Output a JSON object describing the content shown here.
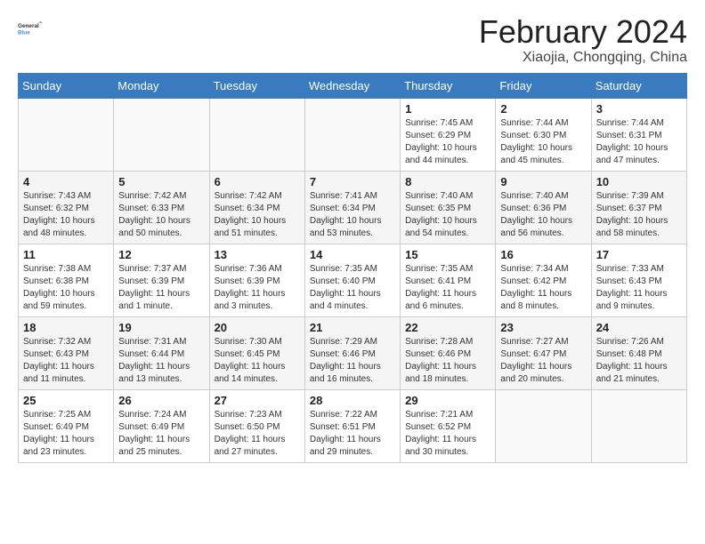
{
  "logo": {
    "text_general": "General",
    "text_blue": "Blue"
  },
  "header": {
    "title": "February 2024",
    "subtitle": "Xiaojia, Chongqing, China"
  },
  "weekdays": [
    "Sunday",
    "Monday",
    "Tuesday",
    "Wednesday",
    "Thursday",
    "Friday",
    "Saturday"
  ],
  "weeks": [
    [
      {
        "day": "",
        "info": ""
      },
      {
        "day": "",
        "info": ""
      },
      {
        "day": "",
        "info": ""
      },
      {
        "day": "",
        "info": ""
      },
      {
        "day": "1",
        "info": "Sunrise: 7:45 AM\nSunset: 6:29 PM\nDaylight: 10 hours and 44 minutes."
      },
      {
        "day": "2",
        "info": "Sunrise: 7:44 AM\nSunset: 6:30 PM\nDaylight: 10 hours and 45 minutes."
      },
      {
        "day": "3",
        "info": "Sunrise: 7:44 AM\nSunset: 6:31 PM\nDaylight: 10 hours and 47 minutes."
      }
    ],
    [
      {
        "day": "4",
        "info": "Sunrise: 7:43 AM\nSunset: 6:32 PM\nDaylight: 10 hours and 48 minutes."
      },
      {
        "day": "5",
        "info": "Sunrise: 7:42 AM\nSunset: 6:33 PM\nDaylight: 10 hours and 50 minutes."
      },
      {
        "day": "6",
        "info": "Sunrise: 7:42 AM\nSunset: 6:34 PM\nDaylight: 10 hours and 51 minutes."
      },
      {
        "day": "7",
        "info": "Sunrise: 7:41 AM\nSunset: 6:34 PM\nDaylight: 10 hours and 53 minutes."
      },
      {
        "day": "8",
        "info": "Sunrise: 7:40 AM\nSunset: 6:35 PM\nDaylight: 10 hours and 54 minutes."
      },
      {
        "day": "9",
        "info": "Sunrise: 7:40 AM\nSunset: 6:36 PM\nDaylight: 10 hours and 56 minutes."
      },
      {
        "day": "10",
        "info": "Sunrise: 7:39 AM\nSunset: 6:37 PM\nDaylight: 10 hours and 58 minutes."
      }
    ],
    [
      {
        "day": "11",
        "info": "Sunrise: 7:38 AM\nSunset: 6:38 PM\nDaylight: 10 hours and 59 minutes."
      },
      {
        "day": "12",
        "info": "Sunrise: 7:37 AM\nSunset: 6:39 PM\nDaylight: 11 hours and 1 minute."
      },
      {
        "day": "13",
        "info": "Sunrise: 7:36 AM\nSunset: 6:39 PM\nDaylight: 11 hours and 3 minutes."
      },
      {
        "day": "14",
        "info": "Sunrise: 7:35 AM\nSunset: 6:40 PM\nDaylight: 11 hours and 4 minutes."
      },
      {
        "day": "15",
        "info": "Sunrise: 7:35 AM\nSunset: 6:41 PM\nDaylight: 11 hours and 6 minutes."
      },
      {
        "day": "16",
        "info": "Sunrise: 7:34 AM\nSunset: 6:42 PM\nDaylight: 11 hours and 8 minutes."
      },
      {
        "day": "17",
        "info": "Sunrise: 7:33 AM\nSunset: 6:43 PM\nDaylight: 11 hours and 9 minutes."
      }
    ],
    [
      {
        "day": "18",
        "info": "Sunrise: 7:32 AM\nSunset: 6:43 PM\nDaylight: 11 hours and 11 minutes."
      },
      {
        "day": "19",
        "info": "Sunrise: 7:31 AM\nSunset: 6:44 PM\nDaylight: 11 hours and 13 minutes."
      },
      {
        "day": "20",
        "info": "Sunrise: 7:30 AM\nSunset: 6:45 PM\nDaylight: 11 hours and 14 minutes."
      },
      {
        "day": "21",
        "info": "Sunrise: 7:29 AM\nSunset: 6:46 PM\nDaylight: 11 hours and 16 minutes."
      },
      {
        "day": "22",
        "info": "Sunrise: 7:28 AM\nSunset: 6:46 PM\nDaylight: 11 hours and 18 minutes."
      },
      {
        "day": "23",
        "info": "Sunrise: 7:27 AM\nSunset: 6:47 PM\nDaylight: 11 hours and 20 minutes."
      },
      {
        "day": "24",
        "info": "Sunrise: 7:26 AM\nSunset: 6:48 PM\nDaylight: 11 hours and 21 minutes."
      }
    ],
    [
      {
        "day": "25",
        "info": "Sunrise: 7:25 AM\nSunset: 6:49 PM\nDaylight: 11 hours and 23 minutes."
      },
      {
        "day": "26",
        "info": "Sunrise: 7:24 AM\nSunset: 6:49 PM\nDaylight: 11 hours and 25 minutes."
      },
      {
        "day": "27",
        "info": "Sunrise: 7:23 AM\nSunset: 6:50 PM\nDaylight: 11 hours and 27 minutes."
      },
      {
        "day": "28",
        "info": "Sunrise: 7:22 AM\nSunset: 6:51 PM\nDaylight: 11 hours and 29 minutes."
      },
      {
        "day": "29",
        "info": "Sunrise: 7:21 AM\nSunset: 6:52 PM\nDaylight: 11 hours and 30 minutes."
      },
      {
        "day": "",
        "info": ""
      },
      {
        "day": "",
        "info": ""
      }
    ]
  ]
}
